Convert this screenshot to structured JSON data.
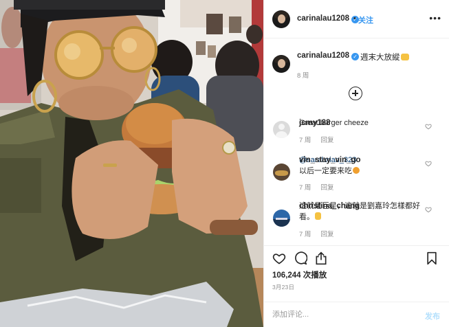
{
  "post": {
    "username": "carinalau1208",
    "follow_label": "关注",
    "separator": "•",
    "more_label": "•••",
    "caption": "週末大放縱",
    "caption_time": "8 周"
  },
  "comments": [
    {
      "username": "jcmy188",
      "text": "Great burger cheeze",
      "time": "7 周",
      "reply_label": "回复"
    },
    {
      "username": "vin_stay_vin_go",
      "mention": "@sarahxian_323",
      "text": "以后一定要来吃",
      "time": "7 周",
      "reply_label": "回复"
    },
    {
      "username": "christina_chang",
      "text": "這就是巨星，這就是劉嘉玲怎樣都好看。",
      "time": "7 周",
      "reply_label": "回复"
    }
  ],
  "stats": {
    "views": "106,244 次播放",
    "date": "3月23日"
  },
  "composer": {
    "placeholder": "添加评论...",
    "post_label": "发布"
  },
  "icons": {
    "verified": "verified-badge-icon",
    "more": "more-options-icon",
    "load_more": "load-more-comments-icon",
    "like": "heart-icon",
    "comment": "comment-bubble-icon",
    "share": "share-icon",
    "save": "bookmark-icon"
  },
  "colors": {
    "link_blue": "#3897f0",
    "muted_text": "#8e8e8e",
    "post_disabled": "#b2dffc"
  }
}
